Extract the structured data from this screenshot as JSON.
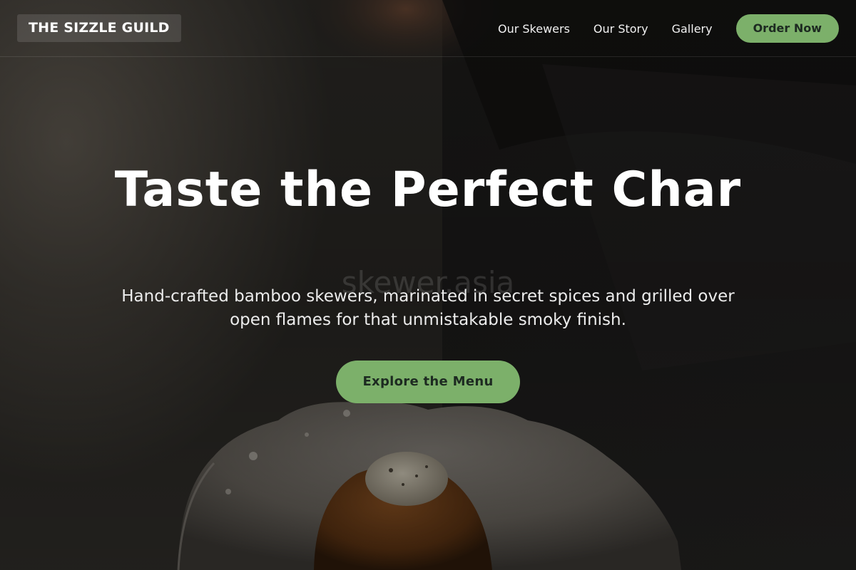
{
  "brand": {
    "name": "THE SIZZLE GUILD"
  },
  "nav": {
    "links": [
      {
        "label": "Our Skewers"
      },
      {
        "label": "Our Story"
      },
      {
        "label": "Gallery"
      }
    ],
    "cta_label": "Order Now"
  },
  "hero": {
    "watermark": "skewer.asia",
    "title": "Taste the Perfect Char",
    "subtitle": "Hand-crafted bamboo skewers, marinated in secret spices and grilled over open flames for that unmistakable smoky finish.",
    "cta_label": "Explore the Menu"
  },
  "colors": {
    "accent": "#7cb06a",
    "accent_text": "#1d2a21",
    "overlay": "#1b1b1a"
  }
}
